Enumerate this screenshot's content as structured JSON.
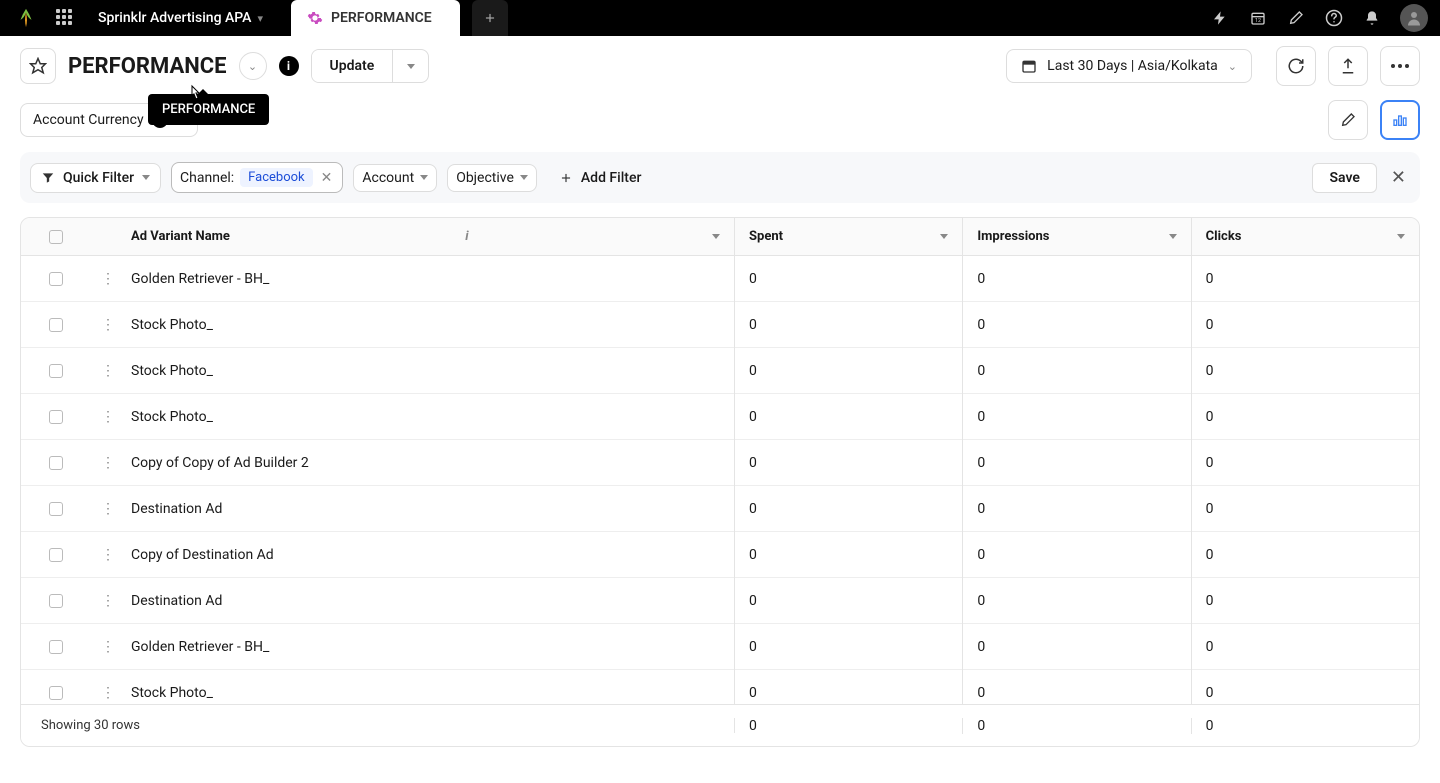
{
  "topbar": {
    "workspace": "Sprinklr Advertising APA",
    "tab_label": "PERFORMANCE"
  },
  "toolbar": {
    "title": "PERFORMANCE",
    "tooltip": "PERFORMANCE",
    "update_label": "Update",
    "date_range": "Last 30 Days | Asia/Kolkata"
  },
  "subbar": {
    "currency_label": "Account Currency"
  },
  "filters": {
    "quick_filter": "Quick Filter",
    "channel_label": "Channel:",
    "channel_value": "Facebook",
    "account_label": "Account",
    "objective_label": "Objective",
    "add_filter_label": "Add Filter",
    "save_label": "Save"
  },
  "table": {
    "headers": {
      "name": "Ad Variant Name",
      "spent": "Spent",
      "impressions": "Impressions",
      "clicks": "Clicks"
    },
    "rows": [
      {
        "name": "Golden Retriever - BH_",
        "spent": "0",
        "impressions": "0",
        "clicks": "0"
      },
      {
        "name": "Stock Photo_",
        "spent": "0",
        "impressions": "0",
        "clicks": "0"
      },
      {
        "name": "Stock Photo_",
        "spent": "0",
        "impressions": "0",
        "clicks": "0"
      },
      {
        "name": "Stock Photo_",
        "spent": "0",
        "impressions": "0",
        "clicks": "0"
      },
      {
        "name": "Copy of Copy of Ad Builder 2",
        "spent": "0",
        "impressions": "0",
        "clicks": "0"
      },
      {
        "name": "Destination Ad",
        "spent": "0",
        "impressions": "0",
        "clicks": "0"
      },
      {
        "name": "Copy of Destination Ad",
        "spent": "0",
        "impressions": "0",
        "clicks": "0"
      },
      {
        "name": "Destination Ad",
        "spent": "0",
        "impressions": "0",
        "clicks": "0"
      },
      {
        "name": "Golden Retriever - BH_",
        "spent": "0",
        "impressions": "0",
        "clicks": "0"
      },
      {
        "name": "Stock Photo_",
        "spent": "0",
        "impressions": "0",
        "clicks": "0"
      }
    ],
    "footer": {
      "summary": "Showing 30 rows",
      "spent": "0",
      "impressions": "0",
      "clicks": "0"
    }
  }
}
